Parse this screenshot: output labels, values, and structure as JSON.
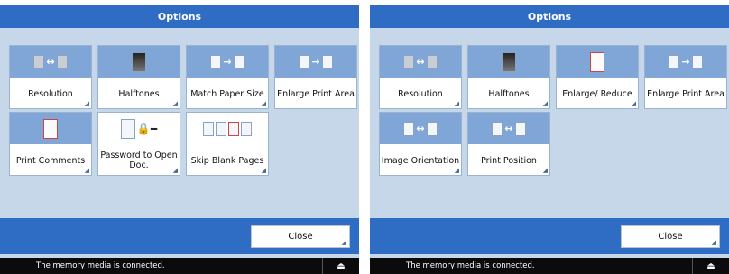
{
  "left": {
    "title": "Options",
    "tiles": [
      {
        "label": "Resolution",
        "icon": "resolution-icon"
      },
      {
        "label": "Halftones",
        "icon": "halftones-icon"
      },
      {
        "label": "Match Paper Size",
        "icon": "match-paper-size-icon"
      },
      {
        "label": "Enlarge Print Area",
        "icon": "enlarge-print-area-icon"
      },
      {
        "label": "Print Comments",
        "icon": "print-comments-icon"
      },
      {
        "label": "Password to Open Doc.",
        "icon": "password-icon"
      },
      {
        "label": "Skip Blank Pages",
        "icon": "skip-blank-pages-icon"
      }
    ],
    "close_label": "Close",
    "status": "The memory media is connected.",
    "eject_icon": "⏏"
  },
  "right": {
    "title": "Options",
    "tiles": [
      {
        "label": "Resolution",
        "icon": "resolution-icon"
      },
      {
        "label": "Halftones",
        "icon": "halftones-icon"
      },
      {
        "label": "Enlarge/ Reduce",
        "icon": "enlarge-reduce-icon"
      },
      {
        "label": "Enlarge Print Area",
        "icon": "enlarge-print-area-icon"
      },
      {
        "label": "Image Orientation",
        "icon": "image-orientation-icon"
      },
      {
        "label": "Print Position",
        "icon": "print-position-icon"
      }
    ],
    "close_label": "Close",
    "status": "The memory media is connected.",
    "eject_icon": "⏏"
  },
  "colors": {
    "title_bar": "#2f6cc4",
    "panel_background": "#c7d7ea",
    "tile_icon_background": "#7fa6d6",
    "status_bar": "#0b0b0b"
  }
}
